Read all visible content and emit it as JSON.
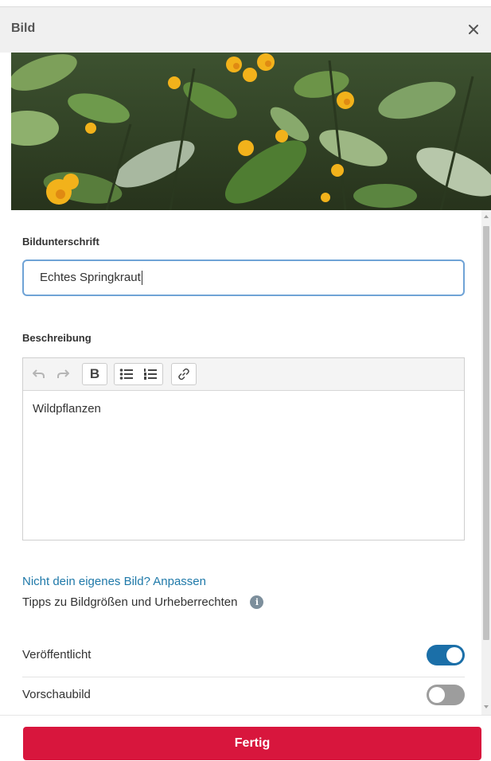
{
  "dialog": {
    "title": "Bild",
    "close_symbol": "×"
  },
  "image": {
    "alt": "Echtes Springkraut"
  },
  "caption": {
    "label": "Bildunterschrift",
    "value": "Echtes Springkraut"
  },
  "description": {
    "label": "Beschreibung",
    "value": "Wildpflanzen",
    "toolbar": {
      "undo_icon": "↶",
      "redo_icon": "↷",
      "bold_label": "B",
      "bullet_list_icon": "bullet-list-icon",
      "numbered_list_icon": "numbered-list-icon",
      "link_icon": "link-icon"
    }
  },
  "links": {
    "not_own_image": "Nicht dein eigenes Bild? Anpassen",
    "tips": "Tipps zu Bildgrößen und Urheberrechten",
    "info_symbol": "i"
  },
  "toggles": [
    {
      "label": "Veröffentlicht",
      "on": true
    },
    {
      "label": "Vorschaubild",
      "on": false
    }
  ],
  "footer": {
    "done_label": "Fertig"
  },
  "colors": {
    "primary_red": "#d8163d",
    "toggle_on": "#1b6fa8",
    "link_blue": "#1f79a9"
  }
}
